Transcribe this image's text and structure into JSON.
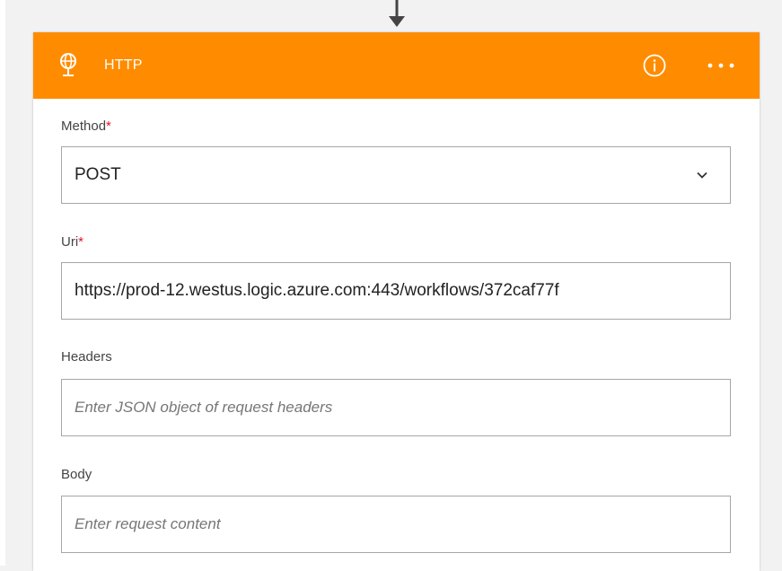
{
  "card": {
    "title": "HTTP",
    "header_color": "#ff8c00",
    "icons": {
      "connector": "arrow-down-icon",
      "header": "globe-icon",
      "info": "info-icon",
      "more": "more-options-icon"
    }
  },
  "fields": {
    "method": {
      "label": "Method",
      "required_mark": "*",
      "value": "POST"
    },
    "uri": {
      "label": "Uri",
      "required_mark": "*",
      "value": "https://prod-12.westus.logic.azure.com:443/workflows/372caf77f"
    },
    "headers": {
      "label": "Headers",
      "placeholder": "Enter JSON object of request headers"
    },
    "body": {
      "label": "Body",
      "placeholder": "Enter request content"
    }
  },
  "colors": {
    "required": "#e81123",
    "field_border": "#a6a6a6",
    "placeholder": "#767676"
  }
}
